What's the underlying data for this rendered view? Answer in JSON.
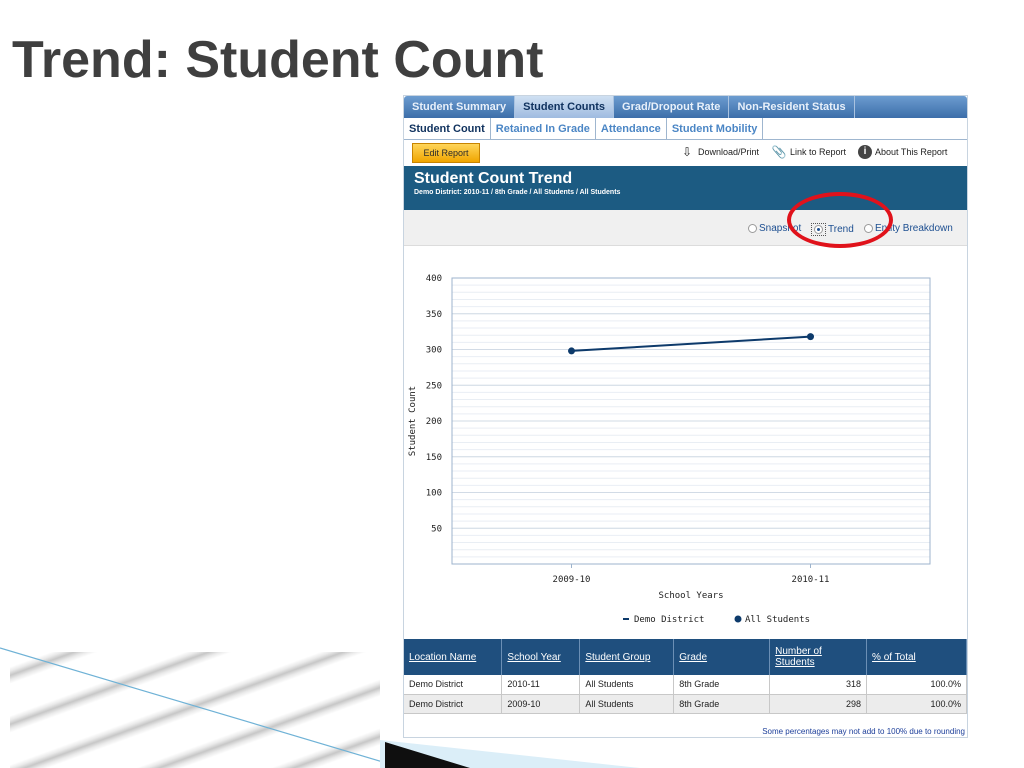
{
  "slide": {
    "title": "Trend: Student Count"
  },
  "main_tabs": [
    {
      "label": "Student Summary",
      "active": false
    },
    {
      "label": "Student Counts",
      "active": true
    },
    {
      "label": "Grad/Dropout Rate",
      "active": false
    },
    {
      "label": "Non-Resident Status",
      "active": false
    }
  ],
  "sub_tabs": [
    {
      "label": "Student Count",
      "active": true
    },
    {
      "label": "Retained In Grade",
      "active": false
    },
    {
      "label": "Attendance",
      "active": false
    },
    {
      "label": "Student Mobility",
      "active": false
    }
  ],
  "toolbar": {
    "edit_label": "Edit Report",
    "download_label": "Download/Print",
    "link_label": "Link to Report",
    "about_label": "About This Report"
  },
  "report": {
    "title": "Student Count Trend",
    "subtitle": "Demo District: 2010-11 / 8th Grade / All Students / All Students"
  },
  "view_options": {
    "snapshot": "Snapshot",
    "trend": "Trend",
    "entity": "Entity Breakdown",
    "selected": "Trend"
  },
  "chart_data": {
    "type": "line",
    "x": [
      "2009-10",
      "2010-11"
    ],
    "series": [
      {
        "name": "All Students",
        "values": [
          298,
          318
        ],
        "color": "#0d3a6b"
      }
    ],
    "xlabel": "School Years",
    "ylabel": "Student Count",
    "ylim": [
      0,
      400
    ],
    "yticks": [
      50,
      100,
      150,
      200,
      250,
      300,
      350,
      400
    ],
    "legend": {
      "district": "Demo District",
      "series": "All Students"
    },
    "grid": true
  },
  "table": {
    "headers": [
      "Location Name",
      "School Year",
      "Student Group",
      "Grade",
      "Number of Students",
      "% of Total"
    ],
    "rows": [
      [
        "Demo District",
        "2010-11",
        "All Students",
        "8th Grade",
        "318",
        "100.0%"
      ],
      [
        "Demo District",
        "2009-10",
        "All Students",
        "8th Grade",
        "298",
        "100.0%"
      ]
    ],
    "footnote": "Some percentages may not add to 100% due to rounding"
  },
  "colors": {
    "header_blue": "#1c5b82",
    "table_header": "#1f4f7e",
    "edit_button": "#f0a500",
    "highlight_red": "#e0121b"
  }
}
